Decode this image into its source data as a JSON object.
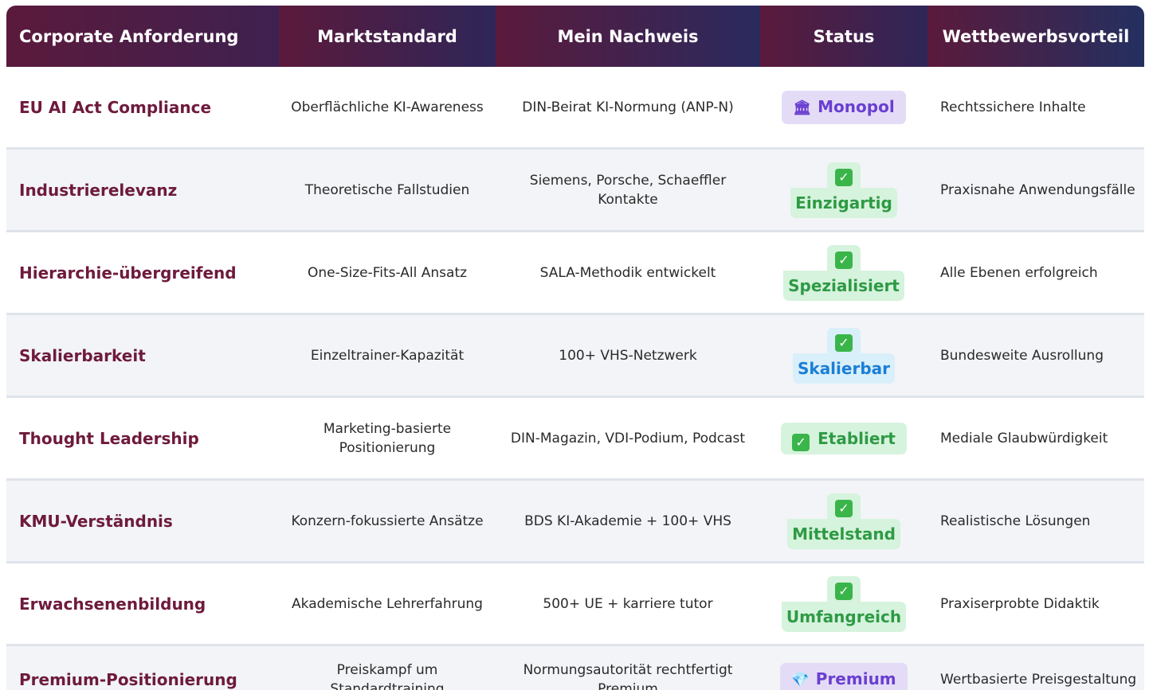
{
  "headers": {
    "c1": "Corporate Anforderung",
    "c2": "Marktstandard",
    "c3": "Mein Nachweis",
    "c4": "Status",
    "c5": "Wettbewerbsvorteil"
  },
  "rows": [
    {
      "requirement": "EU AI Act Compliance",
      "market": "Oberflächliche KI-Awareness",
      "proof": "DIN-Beirat KI-Normung (ANP-N)",
      "status": "Monopol",
      "status_icon": "🏛",
      "advantage": "Rechtssichere Inhalte"
    },
    {
      "requirement": "Industrierelevanz",
      "market": "Theoretische Fallstudien",
      "proof": "Siemens, Porsche, Schaeffler Kontakte",
      "status": "Einzigartig",
      "status_icon": "✓",
      "advantage": "Praxisnahe Anwendungsfälle"
    },
    {
      "requirement": "Hierarchie-übergreifend",
      "market": "One-Size-Fits-All Ansatz",
      "proof": "SALA-Methodik entwickelt",
      "status": "Spezialisiert",
      "status_icon": "✓",
      "advantage": "Alle Ebenen erfolgreich"
    },
    {
      "requirement": "Skalierbarkeit",
      "market": "Einzeltrainer-Kapazität",
      "proof": "100+ VHS-Netzwerk",
      "status": "Skalierbar",
      "status_icon": "✓",
      "advantage": "Bundesweite Ausrollung"
    },
    {
      "requirement": "Thought Leadership",
      "market": "Marketing-basierte Positionierung",
      "proof": "DIN-Magazin, VDI-Podium, Podcast",
      "status": "Etabliert",
      "status_icon": "✓",
      "advantage": "Mediale Glaubwürdigkeit"
    },
    {
      "requirement": "KMU-Verständnis",
      "market": "Konzern-fokussierte Ansätze",
      "proof": "BDS KI-Akademie + 100+ VHS",
      "status": "Mittelstand",
      "status_icon": "✓",
      "advantage": "Realistische Lösungen"
    },
    {
      "requirement": "Erwachsenenbildung",
      "market": "Akademische Lehrerfahrung",
      "proof": "500+ UE + karriere tutor",
      "status": "Umfangreich",
      "status_icon": "✓",
      "advantage": "Praxiserprobte Didaktik"
    },
    {
      "requirement": "Premium-Positionierung",
      "market": "Preiskampf um Standardtraining",
      "proof": "Normungsautorität rechtfertigt Premium",
      "status": "Premium",
      "status_icon": "💎",
      "advantage": "Wertbasierte Preisgestaltung"
    }
  ],
  "colors": {
    "header_start": "#5b1a3c",
    "header_end": "#233060",
    "requirement_text": "#6e1a3c",
    "badge_purple": "#6a3fd0",
    "badge_green": "#2e9a44",
    "badge_blue": "#1a7fd6"
  }
}
